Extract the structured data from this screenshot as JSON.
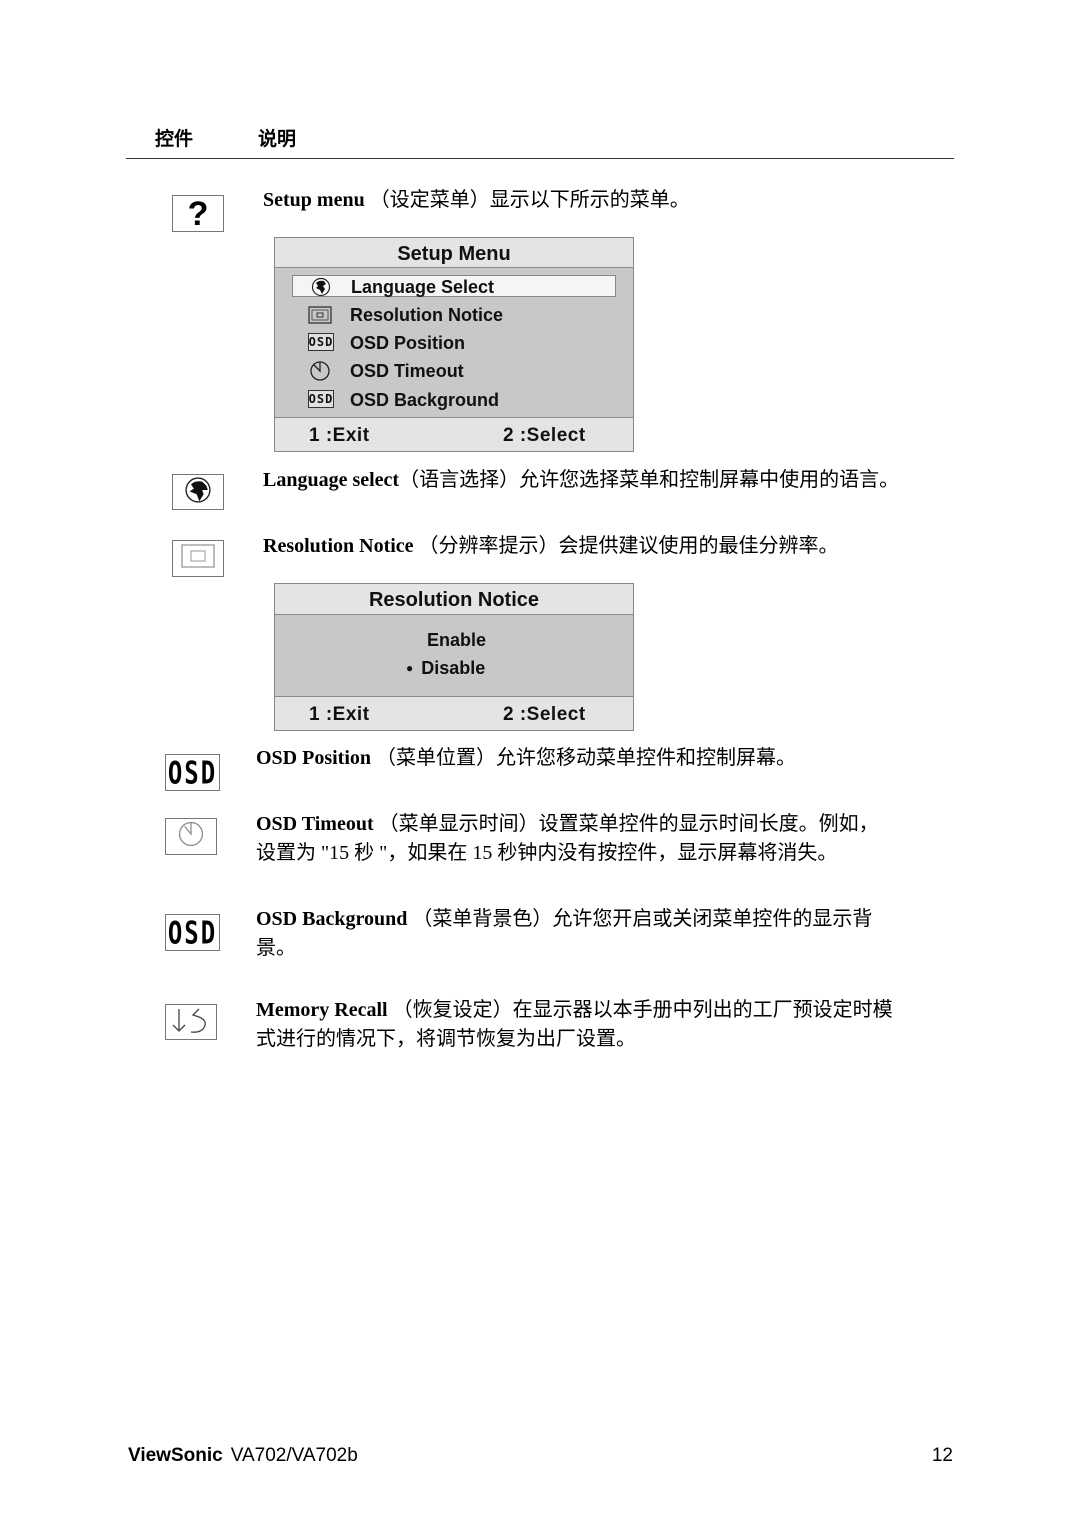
{
  "header": {
    "col_control": "控件",
    "col_description": "说明"
  },
  "items": [
    {
      "icon": "question-mark-icon",
      "term": "Setup menu",
      "text": " （设定菜单）显示以下所示的菜单。"
    },
    {
      "icon": "globe-icon",
      "term": "Language select",
      "text": "（语言选择）允许您选择菜单和控制屏幕中使用的语言。"
    },
    {
      "icon": "resolution-notice-icon",
      "term": "Resolution Notice",
      "text": " （分辨率提示）会提供建议使用的最佳分辨率。"
    },
    {
      "icon": "osd-icon",
      "icon_text": "OSD",
      "term": "OSD Position",
      "text": " （菜单位置）允许您移动菜单控件和控制屏幕。"
    },
    {
      "icon": "clock-icon",
      "term": "OSD Timeout",
      "text": " （菜单显示时间）设置菜单控件的显示时间长度。例如，",
      "text_line2": "设置为 \"15 秒 \"，如果在 15 秒钟内没有按控件，显示屏幕将消失。"
    },
    {
      "icon": "osd-icon",
      "icon_text": "OSD",
      "term": "OSD Background",
      "text": " （菜单背景色）允许您开启或关闭菜单控件的显示背",
      "text_line2": "景。"
    },
    {
      "icon": "memory-recall-icon",
      "term": "Memory Recall",
      "text": " （恢复设定）在显示器以本手册中列出的工厂预设定时模",
      "text_line2": "式进行的情况下，将调节恢复为出厂设置。"
    }
  ],
  "setup_menu": {
    "title": "Setup Menu",
    "items": [
      {
        "label": "Language Select",
        "icon": "globe-icon",
        "selected": true
      },
      {
        "label": "Resolution Notice",
        "icon": "resolution-notice-icon",
        "selected": false
      },
      {
        "label": "OSD Position",
        "icon": "osd-icon",
        "icon_text": "OSD",
        "selected": false
      },
      {
        "label": "OSD Timeout",
        "icon": "clock-icon",
        "selected": false
      },
      {
        "label": "OSD Background",
        "icon": "osd-icon",
        "icon_text": "OSD",
        "selected": false
      }
    ],
    "footer": {
      "exit": "1 :Exit",
      "select": "2 :Select"
    }
  },
  "resolution_menu": {
    "title": "Resolution Notice",
    "options": [
      {
        "label": "Enable",
        "selected": false
      },
      {
        "label": "Disable",
        "selected": true
      }
    ],
    "bullet": "●",
    "footer": {
      "exit": "1 :Exit",
      "select": "2 :Select"
    }
  },
  "footer": {
    "brand": "ViewSonic",
    "model": "VA702/VA702b",
    "page": "12"
  },
  "colors": {
    "osd_body": "#c8c8c8",
    "osd_bar": "#e4e4e4",
    "rule": "#333333"
  }
}
